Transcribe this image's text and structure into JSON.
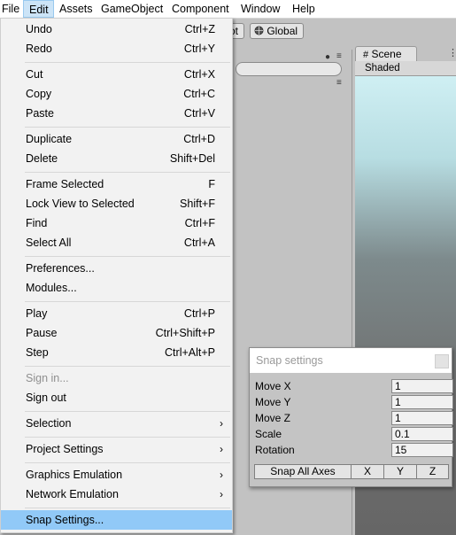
{
  "menubar": [
    "File",
    "Edit",
    "Assets",
    "GameObject",
    "Component",
    "Window",
    "Help"
  ],
  "toolbar": {
    "pivot_partial": "ot",
    "global_label": "Global"
  },
  "scene": {
    "tab_label": "Scene",
    "shading": "Shaded"
  },
  "edit_menu": {
    "items": [
      {
        "label": "Undo",
        "shortcut": "Ctrl+Z"
      },
      {
        "label": "Redo",
        "shortcut": "Ctrl+Y"
      },
      {
        "label": "Cut",
        "shortcut": "Ctrl+X"
      },
      {
        "label": "Copy",
        "shortcut": "Ctrl+C"
      },
      {
        "label": "Paste",
        "shortcut": "Ctrl+V"
      },
      {
        "label": "Duplicate",
        "shortcut": "Ctrl+D"
      },
      {
        "label": "Delete",
        "shortcut": "Shift+Del"
      },
      {
        "label": "Frame Selected",
        "shortcut": "F"
      },
      {
        "label": "Lock View to Selected",
        "shortcut": "Shift+F"
      },
      {
        "label": "Find",
        "shortcut": "Ctrl+F"
      },
      {
        "label": "Select All",
        "shortcut": "Ctrl+A"
      },
      {
        "label": "Preferences...",
        "shortcut": ""
      },
      {
        "label": "Modules...",
        "shortcut": ""
      },
      {
        "label": "Play",
        "shortcut": "Ctrl+P"
      },
      {
        "label": "Pause",
        "shortcut": "Ctrl+Shift+P"
      },
      {
        "label": "Step",
        "shortcut": "Ctrl+Alt+P"
      },
      {
        "label": "Sign in...",
        "shortcut": ""
      },
      {
        "label": "Sign out",
        "shortcut": ""
      },
      {
        "label": "Selection",
        "shortcut": ""
      },
      {
        "label": "Project Settings",
        "shortcut": ""
      },
      {
        "label": "Graphics Emulation",
        "shortcut": ""
      },
      {
        "label": "Network Emulation",
        "shortcut": ""
      },
      {
        "label": "Snap Settings...",
        "shortcut": ""
      }
    ]
  },
  "snap_settings": {
    "title": "Snap settings",
    "rows": [
      {
        "label": "Move X",
        "value": "1"
      },
      {
        "label": "Move Y",
        "value": "1"
      },
      {
        "label": "Move Z",
        "value": "1"
      },
      {
        "label": "Scale",
        "value": "0.1"
      },
      {
        "label": "Rotation",
        "value": "15"
      }
    ],
    "buttons": {
      "all": "Snap All Axes",
      "x": "X",
      "y": "Y",
      "z": "Z"
    }
  },
  "colors": {
    "menu_highlight": "#91c9f7",
    "menubar_active": "#cce4f7"
  }
}
